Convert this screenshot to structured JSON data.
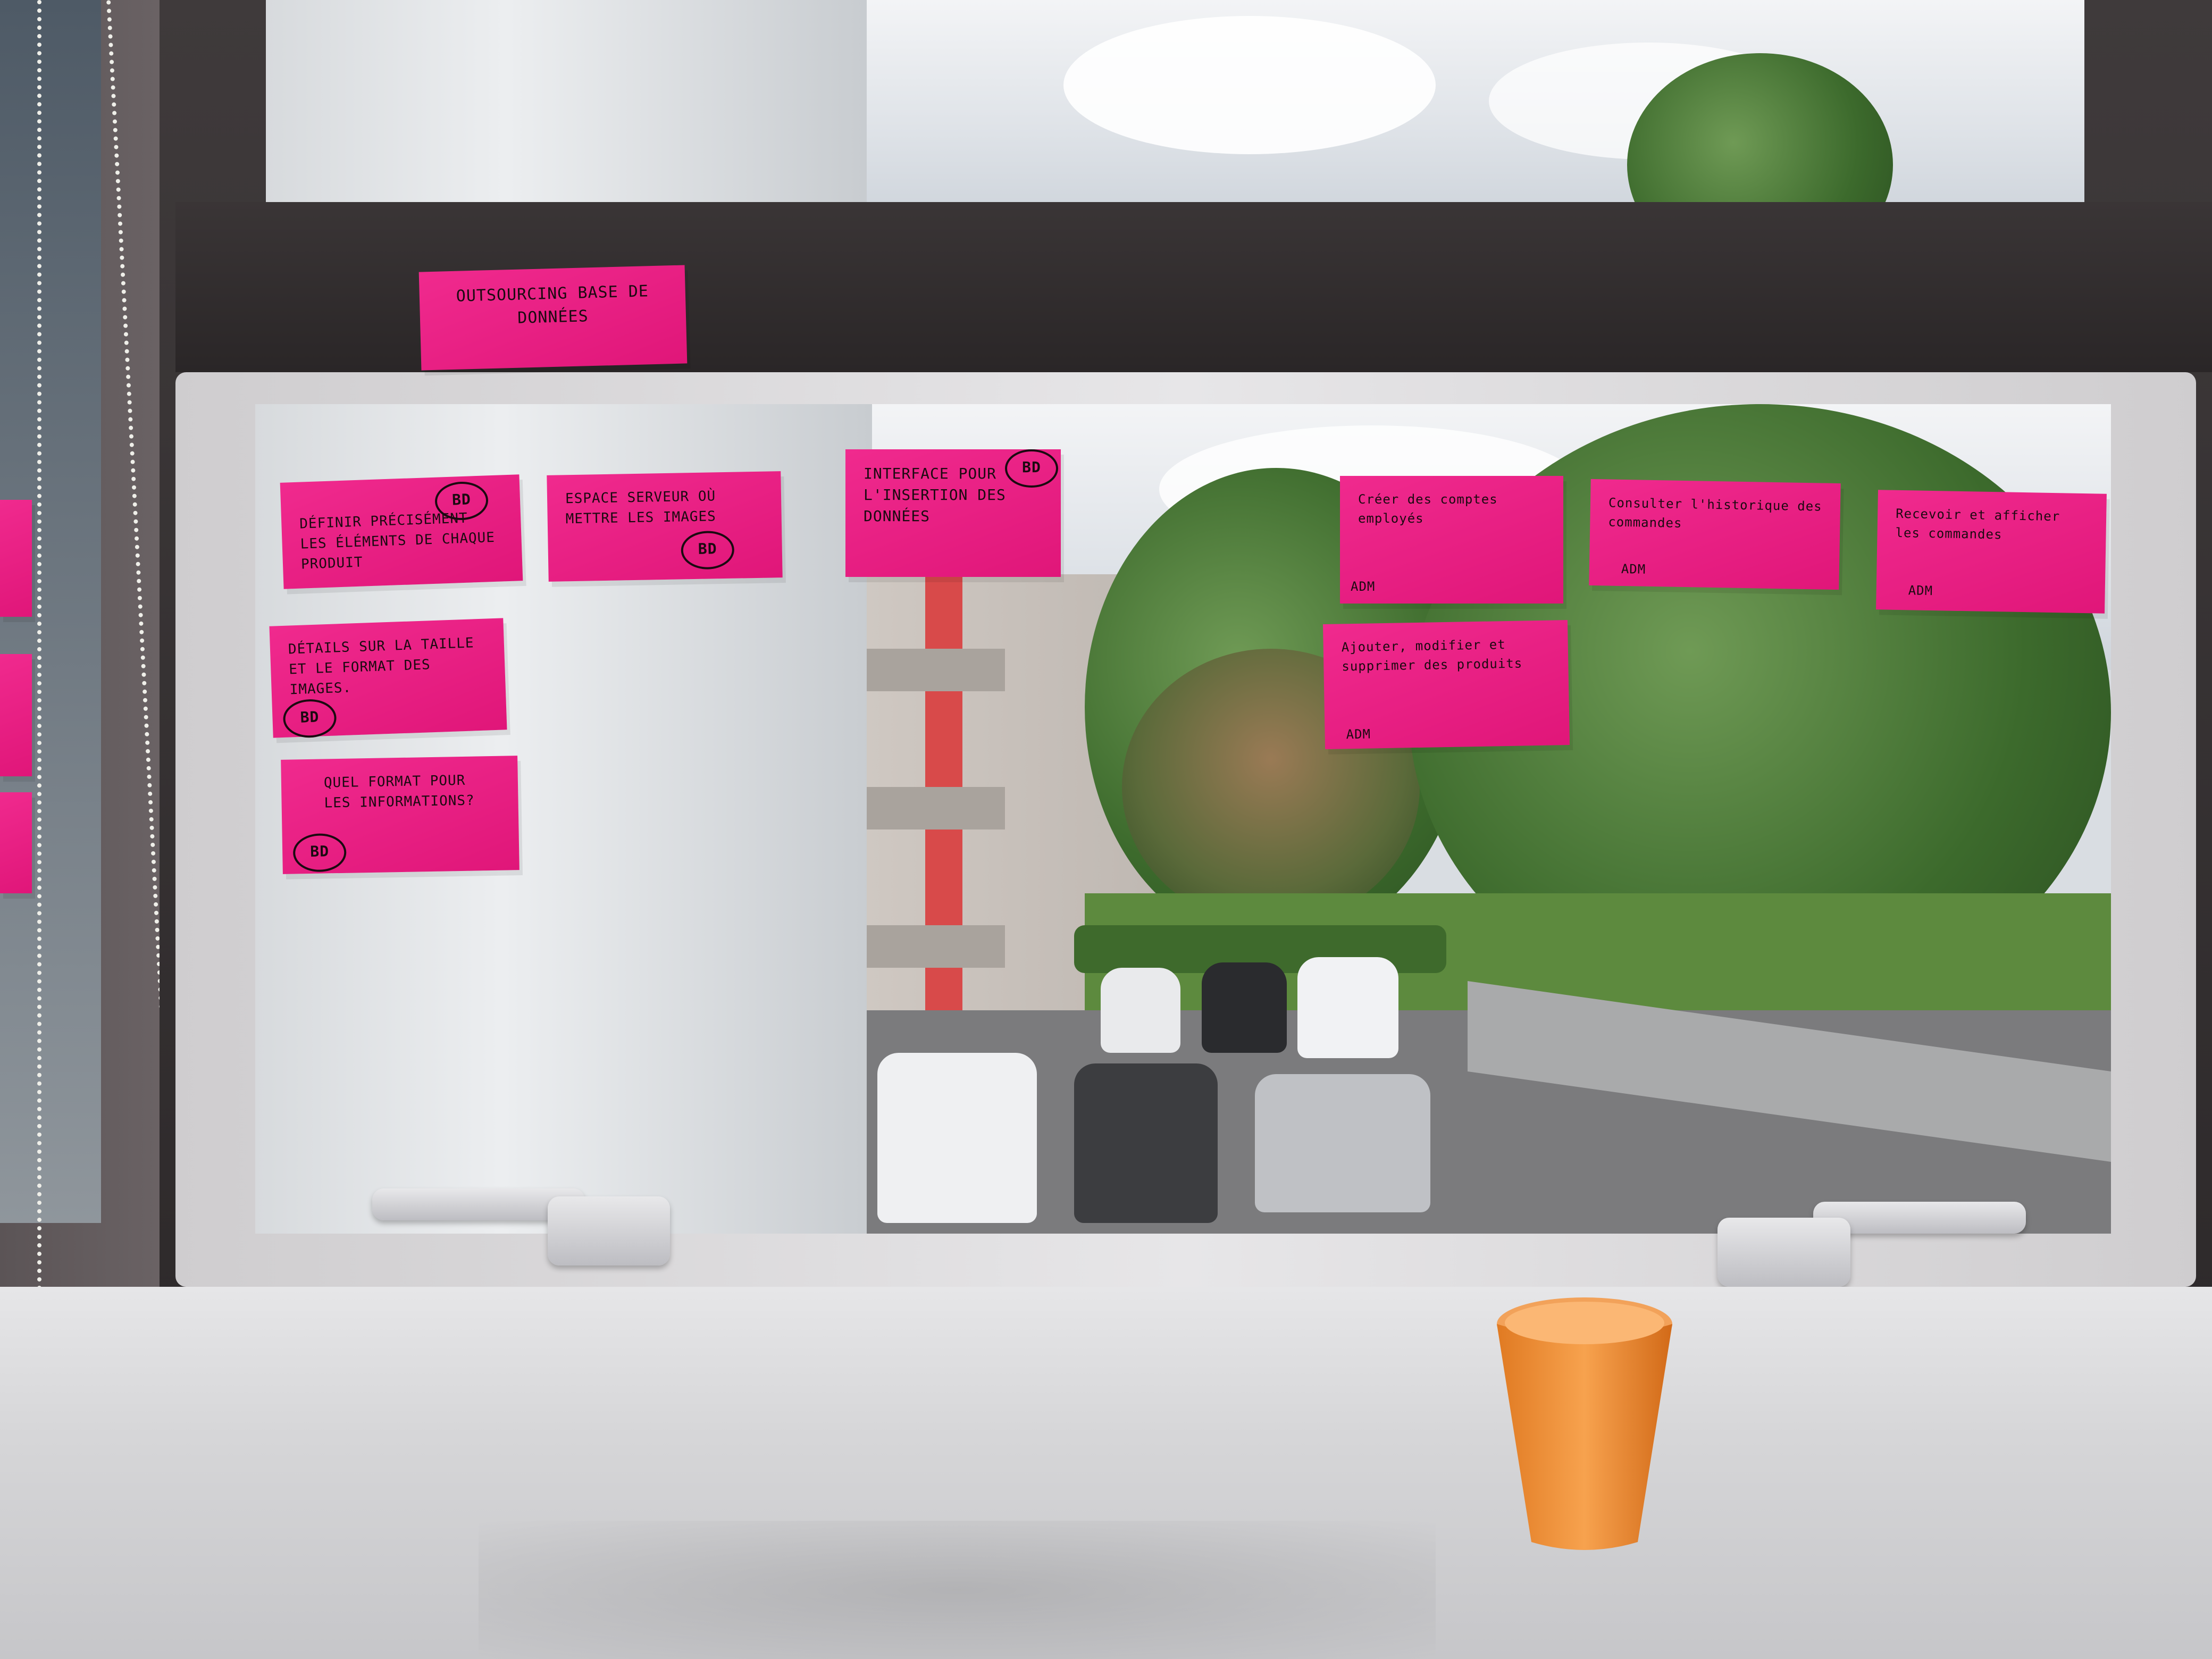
{
  "sticky_notes": {
    "top": {
      "text": "Outsourcing base de données"
    },
    "left": [
      {
        "text": "Définir précisément les éléments de chaque produit",
        "tag": "BD"
      },
      {
        "text": "Espace serveur où mettre les images",
        "tag": "BD"
      },
      {
        "text": "Interface pour l'insertion des données",
        "tag": "BD"
      },
      {
        "text": "Détails sur la taille et le format des images.",
        "tag": "BD"
      },
      {
        "text": "Quel format pour les informations?",
        "tag": "BD"
      }
    ],
    "right": [
      {
        "text": "Créer des comptes employés",
        "tag": "ADM"
      },
      {
        "text": "Consulter l'historique des commandes",
        "tag": "ADM"
      },
      {
        "text": "Recevoir et afficher les commandes",
        "tag": "ADM"
      },
      {
        "text": "Ajouter, modifier et supprimer des produits",
        "tag": "ADM"
      }
    ]
  },
  "objects": {
    "cup_color": "#f08a2c",
    "note_color": "#e81c82",
    "frame_color": "#d8d7d9"
  }
}
